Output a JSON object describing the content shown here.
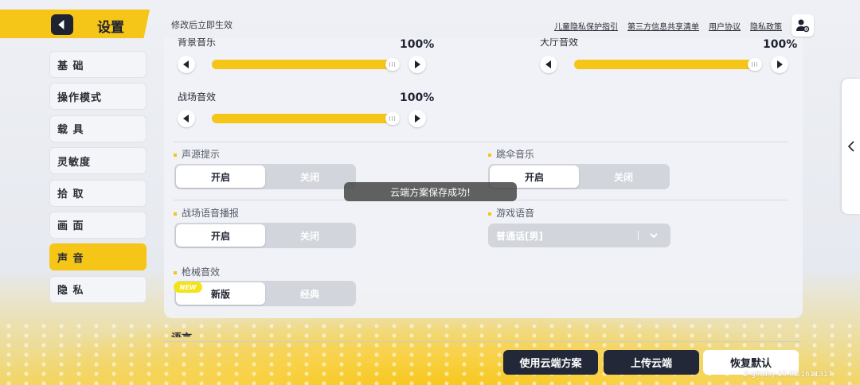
{
  "header": {
    "title": "设置",
    "notice": "修改后立即生效",
    "links": [
      "儿童隐私保护指引",
      "第三方信息共享清单",
      "用户协议",
      "隐私政策"
    ]
  },
  "sidebar": {
    "items": [
      {
        "label": "基 础"
      },
      {
        "label": "操作模式"
      },
      {
        "label": "载 具"
      },
      {
        "label": "灵敏度"
      },
      {
        "label": "拾 取"
      },
      {
        "label": "画 面"
      },
      {
        "label": "声 音",
        "active": true
      },
      {
        "label": "隐 私"
      }
    ]
  },
  "sliders": {
    "bgm": {
      "label": "背景音乐",
      "value_text": "100%",
      "level": 100
    },
    "lobby": {
      "label": "大厅音效",
      "value_text": "100%",
      "level": 100
    },
    "battle": {
      "label": "战场音效",
      "value_text": "100%",
      "level": 100
    }
  },
  "options": {
    "sound_hint": {
      "label": "声源提示",
      "on": "开启",
      "off": "关闭",
      "selected": "on"
    },
    "parachute_music": {
      "label": "跳伞音乐",
      "on": "开启",
      "off": "关闭",
      "selected": "on"
    },
    "battle_voice": {
      "label": "战场语音播报",
      "on": "开启",
      "off": "关闭",
      "selected": "on"
    },
    "game_voice": {
      "label": "游戏语音",
      "value": "普通话[男]"
    },
    "gun_sound": {
      "label": "枪械音效",
      "on": "新版",
      "off": "经典",
      "selected": "on",
      "badge": "NEW"
    }
  },
  "toast": "云端方案保存成功!",
  "cut_heading": "语言",
  "buttons": {
    "use_cloud": "使用云端方案",
    "upload_cloud": "上传云端",
    "restore_default": "恢复默认"
  },
  "version": "2-g9rdsy-15.02.1611317",
  "colors": {
    "accent": "#f5c518",
    "dark_button": "#232838"
  }
}
